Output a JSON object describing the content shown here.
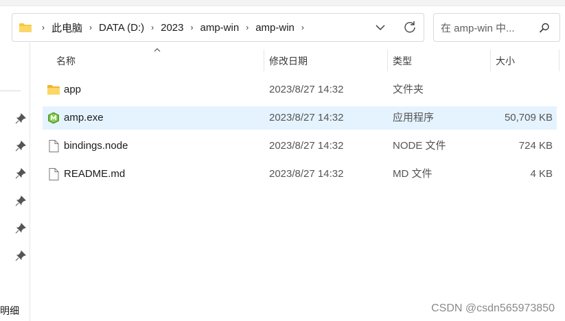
{
  "address": {
    "breadcrumbs": [
      "此电脑",
      "DATA (D:)",
      "2023",
      "amp-win",
      "amp-win"
    ]
  },
  "search": {
    "placeholder": "在 amp-win 中..."
  },
  "columns": {
    "name": "名称",
    "date": "修改日期",
    "type": "类型",
    "size": "大小"
  },
  "files": [
    {
      "name": "app",
      "date": "2023/8/27 14:32",
      "type": "文件夹",
      "size": "",
      "icon": "folder-icon"
    },
    {
      "name": "amp.exe",
      "date": "2023/8/27 14:32",
      "type": "应用程序",
      "size": "50,709 KB",
      "icon": "exe-shield-icon",
      "selected": true
    },
    {
      "name": "bindings.node",
      "date": "2023/8/27 14:32",
      "type": "NODE 文件",
      "size": "724 KB",
      "icon": "file-icon"
    },
    {
      "name": "README.md",
      "date": "2023/8/27 14:32",
      "type": "MD 文件",
      "size": "4 KB",
      "icon": "file-icon"
    }
  ],
  "nav": {
    "detail_label": "明细"
  },
  "watermark": "CSDN @csdn565973850",
  "colors": {
    "selected_row": "#e5f3ff",
    "folder": "#f8c73f",
    "exe": "#6fb83a"
  }
}
